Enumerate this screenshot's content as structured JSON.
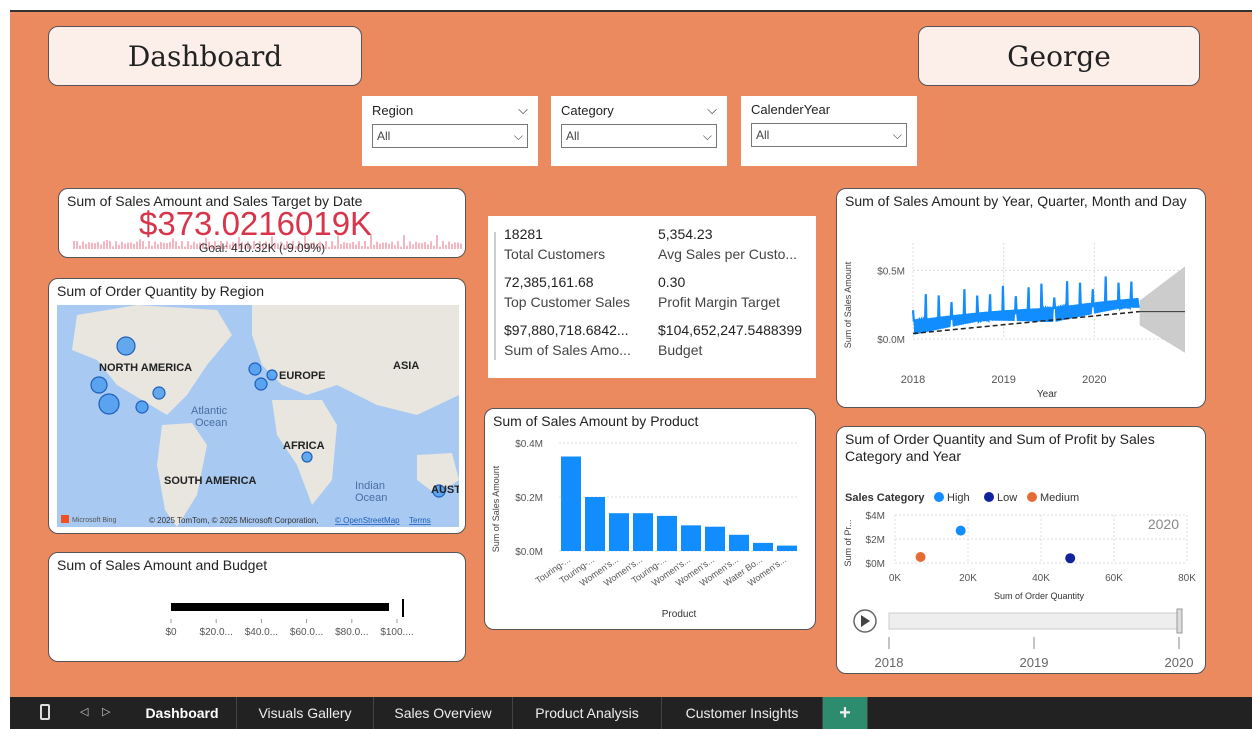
{
  "header": {
    "dashboard_title": "Dashboard",
    "user_name": "George"
  },
  "slicers": [
    {
      "label": "Region",
      "value": "All"
    },
    {
      "label": "Category",
      "value": "All"
    },
    {
      "label": "CalenderYear",
      "value": "All"
    }
  ],
  "kpi_target": {
    "title": "Sum of Sales Amount and Sales Target by Date",
    "value": "$373.0216019K",
    "goal": "Goal: 410.32K (-9.09%)",
    "value_color": "#D8344A"
  },
  "multi_kpi": [
    {
      "value": "18281",
      "label": "Total Customers"
    },
    {
      "value": "5,354.23",
      "label": "Avg Sales per Custo..."
    },
    {
      "value": "72,385,161.68",
      "label": "Top Customer Sales"
    },
    {
      "value": "0.30",
      "label": "Profit Margin Target"
    },
    {
      "value": "$97,880,718.6842...",
      "label": "Sum of Sales Amo..."
    },
    {
      "value": "$104,652,247.5488399",
      "label": "Budget"
    }
  ],
  "map": {
    "title": "Sum of Order Quantity by Region",
    "labels": [
      "NORTH AMERICA",
      "EUROPE",
      "ASIA",
      "Atlantic",
      "Ocean",
      "AFRICA",
      "SOUTH AMERICA",
      "Indian",
      "Ocean",
      "AUST"
    ],
    "attribution": "© 2025 TomTom, © 2025 Microsoft Corporation,",
    "osm": "© OpenStreetMap",
    "terms": "Terms",
    "bing": "Microsoft Bing"
  },
  "bullet": {
    "title": "Sum of Sales Amount and Budget",
    "ticks": [
      "$0",
      "$20.0...",
      "$40.0...",
      "$60.0...",
      "$80.0...",
      "$100...."
    ]
  },
  "charts": {
    "product_title": "Sum of Sales Amount by Product",
    "product_ylabel": "Sum of Sales Amount",
    "product_xlabel": "Product",
    "line_title": "Sum of Sales Amount by Year, Quarter, Month and Day",
    "line_ylabel": "Sum of Sales Amount",
    "line_xlabel": "Year",
    "scatter_title": "Sum of Order Quantity and Sum of Profit by Sales Category and Year",
    "scatter_ylabel": "Sum of Pr...",
    "scatter_xlabel": "Sum of Order Quantity",
    "legend_title": "Sales Category",
    "play_axis": [
      "2018",
      "2019",
      "2020"
    ]
  },
  "chart_data": [
    {
      "type": "bar",
      "title": "Sum of Sales Amount by Product",
      "categories": [
        "Touring-...",
        "Touring-...",
        "Women's...",
        "Women's...",
        "Touring-...",
        "Women's...",
        "Women's...",
        "Women's...",
        "Water Bo...",
        "Women's..."
      ],
      "values": [
        0.35,
        0.2,
        0.14,
        0.14,
        0.13,
        0.095,
        0.09,
        0.06,
        0.03,
        0.02
      ],
      "yticks": [
        "$0.0M",
        "$0.2M",
        "$0.4M"
      ],
      "ylim": [
        0,
        0.4
      ],
      "color": "#118DFF"
    },
    {
      "type": "line",
      "title": "Sum of Sales Amount by Year, Quarter, Month and Day",
      "xticks": [
        "2018",
        "2019",
        "2020"
      ],
      "yticks": [
        "$0.0M",
        "$0.5M"
      ],
      "xlim": [
        2018,
        2021
      ],
      "ylim": [
        0,
        0.7
      ],
      "trend": [
        [
          2018,
          0.04
        ],
        [
          2020.5,
          0.2
        ]
      ],
      "forecast_band": true,
      "color": "#118DFF"
    },
    {
      "type": "scatter",
      "title": "Sum of Order Quantity and Sum of Profit by Sales Category and Year",
      "series": [
        {
          "name": "High",
          "color": "#118DFF",
          "points": [
            [
              18000,
              2.7
            ]
          ]
        },
        {
          "name": "Low",
          "color": "#12239E",
          "points": [
            [
              48000,
              0.4
            ]
          ]
        },
        {
          "name": "Medium",
          "color": "#E66C37",
          "points": [
            [
              7000,
              0.5
            ]
          ]
        }
      ],
      "xticks": [
        "0K",
        "20K",
        "40K",
        "60K",
        "80K"
      ],
      "yticks": [
        "$0M",
        "$2M",
        "$4M"
      ],
      "xlim": [
        0,
        80000
      ],
      "ylim": [
        0,
        4
      ],
      "year_label": "2020"
    }
  ],
  "taskbar": {
    "tabs": [
      "Dashboard",
      "Visuals Gallery",
      "Sales Overview",
      "Product Analysis",
      "Customer Insights"
    ],
    "add_label": "+"
  }
}
